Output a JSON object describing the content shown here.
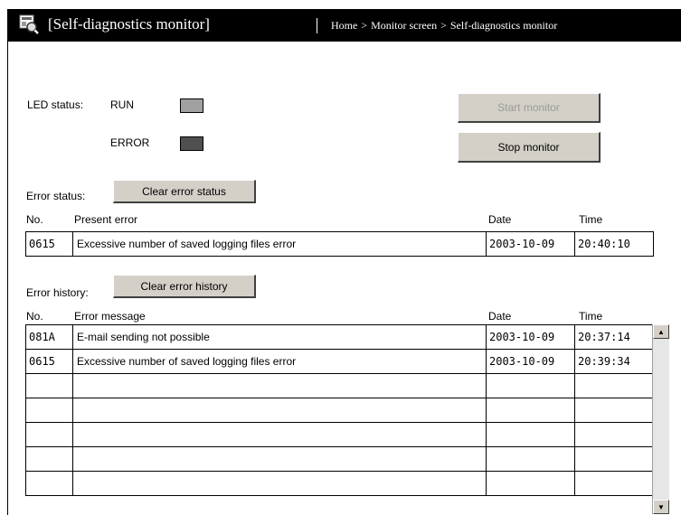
{
  "header": {
    "title": "[Self-diagnostics monitor]",
    "breadcrumb": [
      "Home",
      "Monitor screen",
      "Self-diagnostics monitor"
    ],
    "breadcrumb_separator": ">"
  },
  "led_status": {
    "label": "LED status:",
    "indicators": [
      {
        "name": "RUN",
        "color": "#a0a0a0"
      },
      {
        "name": "ERROR",
        "color": "#505050"
      }
    ]
  },
  "buttons": {
    "start_monitor": "Start monitor",
    "stop_monitor": "Stop monitor",
    "clear_error_status": "Clear error status",
    "clear_error_history": "Clear error history"
  },
  "error_status": {
    "label": "Error status:",
    "columns": {
      "no": "No.",
      "message": "Present error",
      "date": "Date",
      "time": "Time"
    },
    "row": {
      "no": "0615",
      "message": "Excessive number of saved logging files error",
      "date": "2003-10-09",
      "time": "20:40:10"
    }
  },
  "error_history": {
    "label": "Error history:",
    "columns": {
      "no": "No.",
      "message": "Error message",
      "date": "Date",
      "time": "Time"
    },
    "rows": [
      {
        "no": "081A",
        "message": "E-mail sending not possible",
        "date": "2003-10-09",
        "time": "20:37:14"
      },
      {
        "no": "0615",
        "message": "Excessive number of saved logging files error",
        "date": "2003-10-09",
        "time": "20:39:34"
      },
      {
        "no": "",
        "message": "",
        "date": "",
        "time": ""
      },
      {
        "no": "",
        "message": "",
        "date": "",
        "time": ""
      },
      {
        "no": "",
        "message": "",
        "date": "",
        "time": ""
      },
      {
        "no": "",
        "message": "",
        "date": "",
        "time": ""
      },
      {
        "no": "",
        "message": "",
        "date": "",
        "time": ""
      }
    ]
  },
  "scrollbar": {
    "up_icon": "arrow-up-icon",
    "down_icon": "arrow-down-icon"
  }
}
